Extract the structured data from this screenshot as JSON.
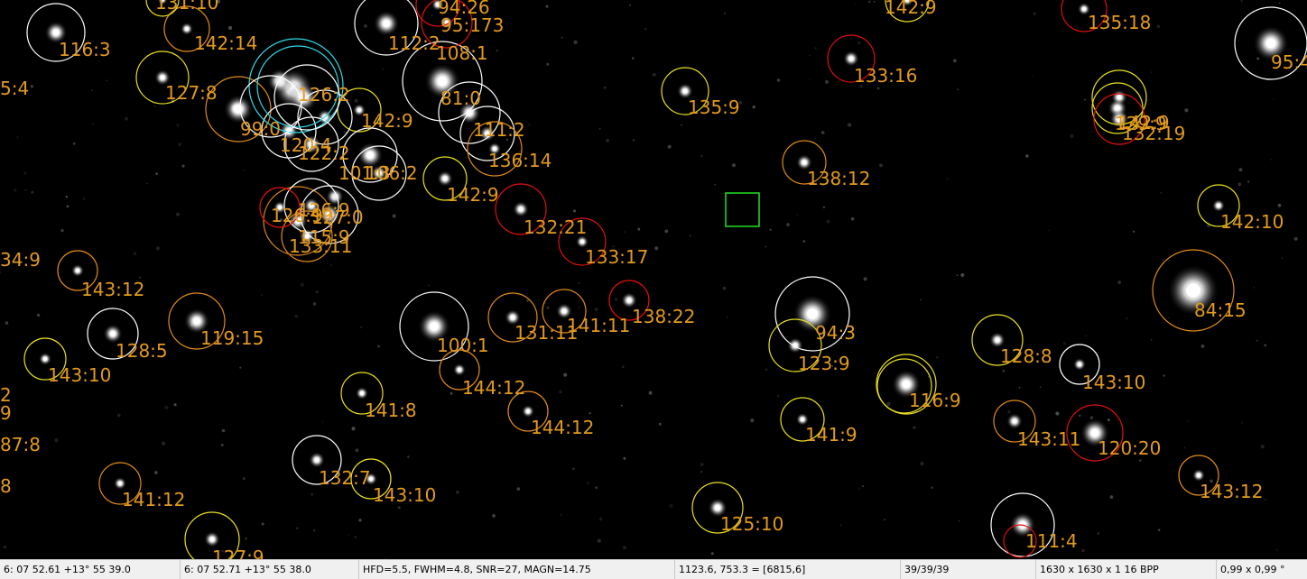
{
  "colors": {
    "label": "#e39a1e",
    "ring_white": "#ffffff",
    "ring_yellow": "#e8e020",
    "ring_orange": "#e08a1c",
    "ring_red": "#e01010",
    "ring_cyan": "#30d8e8",
    "marker_green": "#20e020"
  },
  "annotations": [
    {
      "label": "116:3",
      "ring": "white"
    },
    {
      "label": "142:14",
      "ring": "orange"
    },
    {
      "label": "127:8",
      "ring": "yellow"
    },
    {
      "label": "99:0",
      "ring": "orange"
    },
    {
      "label": "142:9",
      "ring": "yellow"
    },
    {
      "label": "101:3",
      "ring": "white"
    },
    {
      "label": "106:2",
      "ring": "white"
    },
    {
      "label": "142:9",
      "ring": "yellow"
    },
    {
      "label": "133:11",
      "ring": "orange"
    },
    {
      "label": "112:2",
      "ring": "white"
    },
    {
      "label": "108:1",
      "ring": "white"
    },
    {
      "label": "81:0",
      "ring": "white"
    },
    {
      "label": "111:2",
      "ring": "white"
    },
    {
      "label": "136:14",
      "ring": "orange"
    },
    {
      "label": "132:21",
      "ring": "red"
    },
    {
      "label": "133:17",
      "ring": "red"
    },
    {
      "label": "135:9",
      "ring": "yellow"
    },
    {
      "label": "133:16",
      "ring": "red"
    },
    {
      "label": "138:12",
      "ring": "orange"
    },
    {
      "label": "142:9",
      "ring": "yellow"
    },
    {
      "label": "135:18",
      "ring": "red"
    },
    {
      "label": "95:4",
      "ring": "white"
    },
    {
      "label": "129:9",
      "ring": "yellow"
    },
    {
      "label": "132:19",
      "ring": "red"
    },
    {
      "label": "142:10",
      "ring": "yellow"
    },
    {
      "label": "84:15",
      "ring": "orange"
    },
    {
      "label": "5:4",
      "ring": "none"
    },
    {
      "label": "34:9",
      "ring": "none"
    },
    {
      "label": "143:12",
      "ring": "orange"
    },
    {
      "label": "119:15",
      "ring": "orange"
    },
    {
      "label": "128:5",
      "ring": "white"
    },
    {
      "label": "143:10",
      "ring": "yellow"
    },
    {
      "label": "100:1",
      "ring": "white"
    },
    {
      "label": "131:11",
      "ring": "orange"
    },
    {
      "label": "141:11",
      "ring": "orange"
    },
    {
      "label": "138:22",
      "ring": "red"
    },
    {
      "label": "144:12",
      "ring": "orange"
    },
    {
      "label": "141:8",
      "ring": "yellow"
    },
    {
      "label": "144:12",
      "ring": "orange"
    },
    {
      "label": "94:3",
      "ring": "white"
    },
    {
      "label": "123:9",
      "ring": "yellow"
    },
    {
      "label": "141:9",
      "ring": "yellow"
    },
    {
      "label": "116:9",
      "ring": "yellow"
    },
    {
      "label": "128:8",
      "ring": "yellow"
    },
    {
      "label": "143:10",
      "ring": "white"
    },
    {
      "label": "143:11",
      "ring": "orange"
    },
    {
      "label": "120:20",
      "ring": "red"
    },
    {
      "label": "143:12",
      "ring": "orange"
    },
    {
      "label": "132:7",
      "ring": "white"
    },
    {
      "label": "143:10",
      "ring": "yellow"
    },
    {
      "label": "141:12",
      "ring": "orange"
    },
    {
      "label": "125:10",
      "ring": "yellow"
    },
    {
      "label": "111:4",
      "ring": "white"
    },
    {
      "label": "2",
      "ring": "none"
    },
    {
      "label": "9",
      "ring": "none"
    },
    {
      "label": "87:8",
      "ring": "none"
    },
    {
      "label": "8",
      "ring": "none"
    },
    {
      "label": "142:9",
      "ring": "yellow"
    },
    {
      "label": "94:26",
      "ring": "red"
    },
    {
      "label": "95:173",
      "ring": "red"
    },
    {
      "label": "131:10",
      "ring": "yellow"
    },
    {
      "label": "126:9",
      "ring": "white"
    },
    {
      "label": "126:2",
      "ring": "white"
    },
    {
      "label": "127:0",
      "ring": "white"
    },
    {
      "label": "115:9",
      "ring": "orange"
    },
    {
      "label": "126:9",
      "ring": "red"
    },
    {
      "label": "122:2",
      "ring": "white"
    },
    {
      "label": "120:4",
      "ring": "white"
    },
    {
      "label": "127:9",
      "ring": "yellow"
    }
  ],
  "status": {
    "coord_cursor": "6: 07  52.61   +13° 55  39.0",
    "coord_selected": "6: 07  52.71   +13° 55  38.0",
    "star_stats": "HFD=5.5, FWHM=4.8, SNR=27, MAGN=14.75",
    "pixel_value": "1123.6, 753.3 = [6815,6]",
    "file_counter": "39/39/39",
    "image_info": "1630 x 1630 x 1   16 BPP",
    "scale": "0,99 x 0,99 °"
  }
}
